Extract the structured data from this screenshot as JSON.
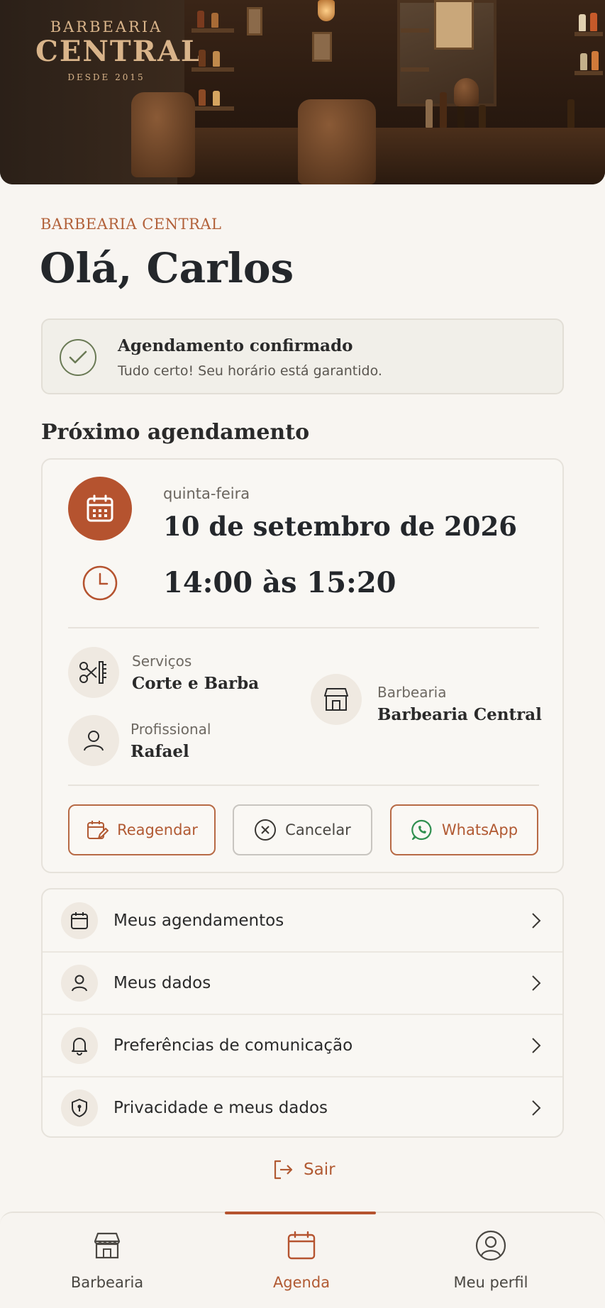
{
  "hero": {
    "sign_top": "BARBEARIA",
    "sign_main": "CENTRAL",
    "sign_since": "DESDE 2015"
  },
  "header": {
    "brand_label": "BARBEARIA CENTRAL",
    "greeting": "Olá, Carlos"
  },
  "confirmation": {
    "title": "Agendamento confirmado",
    "subtitle": "Tudo certo! Seu horário está garantido."
  },
  "next_appointment": {
    "section_title": "Próximo agendamento",
    "weekday": "quinta-feira",
    "date": "10 de setembro de 2026",
    "time": "14:00 às 15:20",
    "services_label": "Serviços",
    "services_value": "Corte e Barba",
    "professional_label": "Profissional",
    "professional_value": "Rafael",
    "shop_label": "Barbearia",
    "shop_value": "Barbearia Central",
    "actions": {
      "reschedule": "Reagendar",
      "cancel": "Cancelar",
      "whatsapp": "WhatsApp"
    }
  },
  "menu": {
    "items": [
      {
        "label": "Meus agendamentos",
        "icon": "calendar-icon"
      },
      {
        "label": "Meus dados",
        "icon": "user-icon"
      },
      {
        "label": "Preferências de comunicação",
        "icon": "bell-icon"
      },
      {
        "label": "Privacidade e meus dados",
        "icon": "shield-icon"
      }
    ]
  },
  "logout_label": "Sair",
  "tabs": [
    {
      "label": "Barbearia",
      "icon": "store-icon",
      "active": false
    },
    {
      "label": "Agenda",
      "icon": "calendar-icon",
      "active": true
    },
    {
      "label": "Meu perfil",
      "icon": "profile-icon",
      "active": false
    }
  ],
  "colors": {
    "accent": "#b5532f",
    "background": "#f8f5f1",
    "success": "#6a7a55",
    "whatsapp": "#2f8f4f"
  }
}
